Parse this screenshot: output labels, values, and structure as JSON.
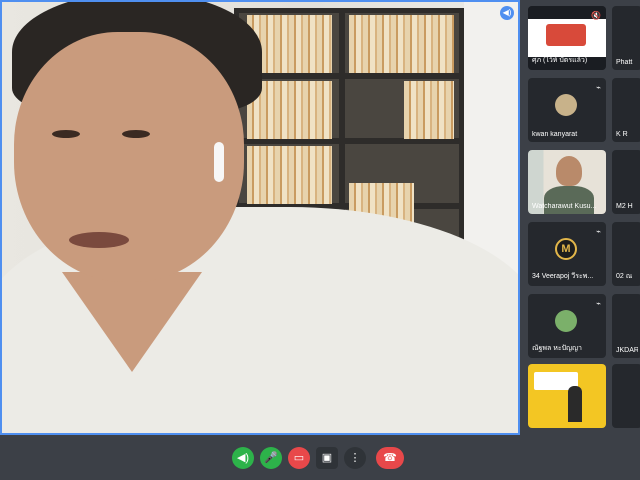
{
  "main_speaker": {
    "audio_indicator": "speaker-on-icon"
  },
  "participants": [
    {
      "name": "ศุภ (ไว้ห์ บัตรแล้ว)",
      "mic": "mic-off-icon",
      "tile": "screen-share"
    },
    {
      "name": "Phatt",
      "mic": "mic-off-icon",
      "tile": "partial"
    },
    {
      "name": "kwan kanyarat",
      "mic": "mic-off-icon",
      "tile": "avatar"
    },
    {
      "name": "K R",
      "mic": "mic-off-icon",
      "tile": "partial"
    },
    {
      "name": "Watcharawut Kusu...",
      "mic": "",
      "tile": "camera"
    },
    {
      "name": "M2 H",
      "mic": "",
      "tile": "partial"
    },
    {
      "name": "34 Veerapoj วีระพ...",
      "mic": "mic-off-icon",
      "tile": "avatar-logo"
    },
    {
      "name": "02 ณ",
      "mic": "mic-off-icon",
      "tile": "partial"
    },
    {
      "name": "ณัฐพล หะปัญญา",
      "mic": "mic-off-icon",
      "tile": "avatar"
    },
    {
      "name": "JKDAR",
      "mic": "mic-off-icon",
      "tile": "partial"
    },
    {
      "name": "",
      "mic": "",
      "tile": "presentation"
    },
    {
      "name": "",
      "mic": "",
      "tile": "partial"
    }
  ],
  "controls": [
    {
      "icon": "volume-icon",
      "color": "#2db34a"
    },
    {
      "icon": "microphone-icon",
      "color": "#2db34a"
    },
    {
      "icon": "video-off-icon",
      "color": "#e8484a"
    },
    {
      "icon": "screen-share-icon",
      "color": "#2f3338"
    },
    {
      "icon": "more-options-icon",
      "color": "#2f3338"
    },
    {
      "icon": "end-call-icon",
      "color": "#e8484a"
    }
  ]
}
